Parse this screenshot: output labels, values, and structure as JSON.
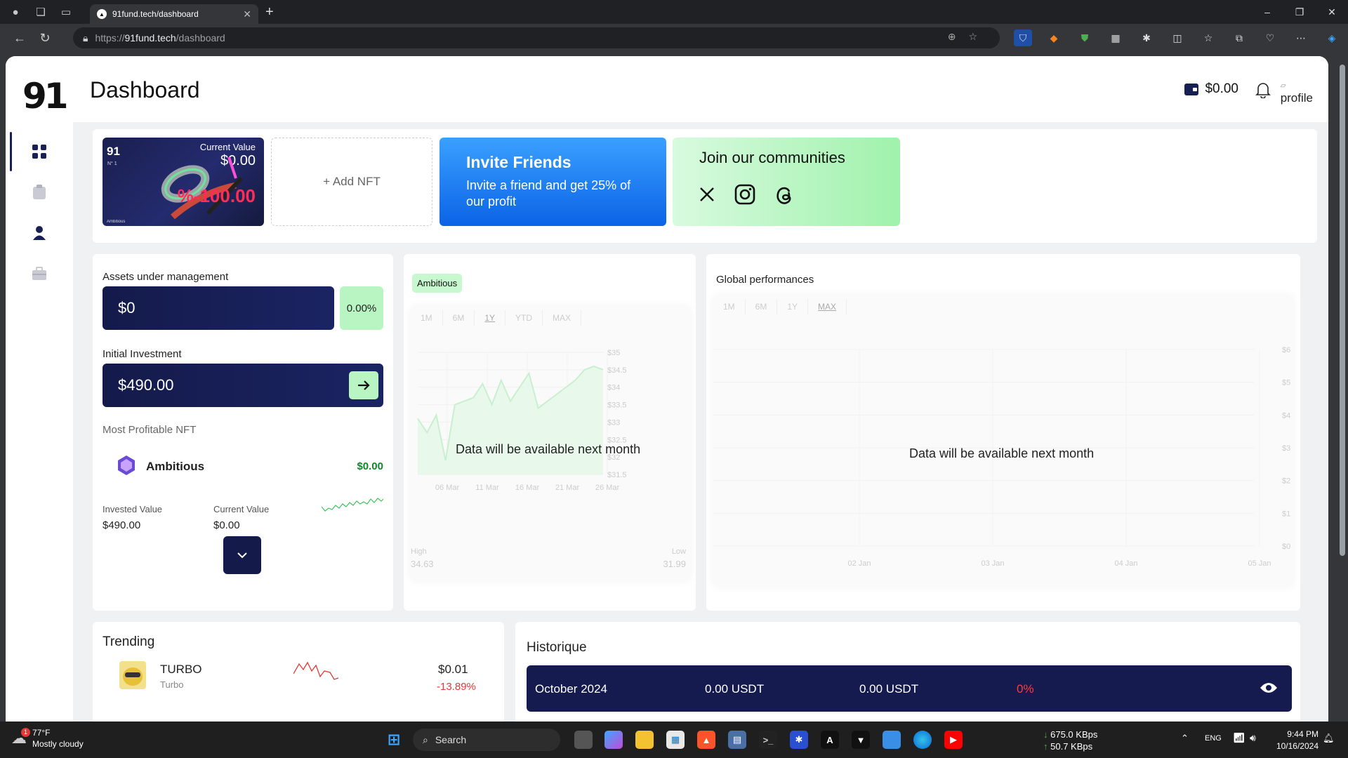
{
  "browser": {
    "tab_title": "91fund.tech/dashboard",
    "url_scheme": "https://",
    "url_host": "91fund.tech",
    "url_path": "/dashboard"
  },
  "app": {
    "logo": "91",
    "page_title": "Dashboard",
    "wallet_balance": "$0.00",
    "profile_alt": "profile"
  },
  "sidebar": {
    "items": [
      {
        "name": "dashboard",
        "icon": "grid-icon",
        "active": true
      },
      {
        "name": "portfolio",
        "icon": "clipboard-icon",
        "active": false
      },
      {
        "name": "account",
        "icon": "user-icon",
        "active": false
      },
      {
        "name": "wallet",
        "icon": "briefcase-icon",
        "active": false
      }
    ]
  },
  "nft_card": {
    "logo": "91",
    "number": "N° 1",
    "current_value_label": "Current Value",
    "current_value": "$0.00",
    "performance": "%-100.00",
    "name": "Ambitious"
  },
  "add_nft_label": "+ Add NFT",
  "invite": {
    "title": "Invite Friends",
    "description": "Invite a friend and get 25% of our profit"
  },
  "communities": {
    "title": "Join our communities",
    "links": [
      "x-icon",
      "instagram-icon",
      "threads-icon"
    ]
  },
  "assets": {
    "aum_label": "Assets under management",
    "aum_value": "$0",
    "aum_change": "0.00%",
    "initial_label": "Initial Investment",
    "initial_value": "$490.00",
    "most_profitable_label": "Most Profitable NFT",
    "nft_name": "Ambitious",
    "nft_value": "$0.00",
    "invested_label": "Invested Value",
    "invested_value": "$490.00",
    "current_label": "Current Value",
    "current_value": "$0.00"
  },
  "nft_chart": {
    "badge": "Ambitious",
    "timeframes": [
      "1M",
      "6M",
      "1Y",
      "YTD",
      "MAX"
    ],
    "selected": "1Y",
    "message": "Data will be available next month",
    "high_label": "High",
    "high_value": "34.63",
    "low_label": "Low",
    "low_value": "31.99"
  },
  "global_chart": {
    "title": "Global performances",
    "timeframes": [
      "1M",
      "6M",
      "1Y",
      "MAX"
    ],
    "selected": "MAX",
    "message": "Data will be available next month"
  },
  "chart_data": [
    {
      "type": "area",
      "title": "",
      "y_ticks": [
        "$35",
        "$34.5",
        "$34",
        "$33.5",
        "$33",
        "$32.5",
        "$32",
        "$31.5"
      ],
      "x_ticks": [
        "06 Mar",
        "11 Mar",
        "16 Mar",
        "21 Mar",
        "26 Mar"
      ],
      "ylim": [
        31.5,
        35
      ],
      "series": [
        {
          "values": [
            33.1,
            32.7,
            33.2,
            31.9,
            33.5,
            33.6,
            33.7,
            34.1,
            33.5,
            34.2,
            33.6,
            34.0,
            34.4,
            33.4,
            33.6,
            33.8,
            34.0,
            34.2,
            34.5,
            34.6,
            34.5
          ]
        }
      ]
    },
    {
      "type": "line",
      "title": "Global performances",
      "y_ticks": [
        "$6",
        "$5",
        "$4",
        "$3",
        "$2",
        "$1",
        "$0"
      ],
      "x_ticks": [
        "02 Jan",
        "03 Jan",
        "04 Jan",
        "05 Jan"
      ],
      "ylim": [
        0,
        6
      ],
      "series": []
    }
  ],
  "trending": {
    "title": "Trending",
    "items": [
      {
        "symbol": "TURBO",
        "name": "Turbo",
        "price": "$0.01",
        "change": "-13.89%"
      }
    ]
  },
  "history": {
    "title": "Historique",
    "rows": [
      {
        "period": "October 2024",
        "amount1": "0.00 USDT",
        "amount2": "0.00 USDT",
        "change": "0%"
      }
    ]
  },
  "taskbar": {
    "temperature": "77°F",
    "weather": "Mostly cloudy",
    "weather_badge": "1",
    "search_placeholder": "Search",
    "net_down": "675.0 KBps",
    "net_up": "50.7 KBps",
    "language": "ENG",
    "time": "9:44 PM",
    "date": "10/16/2024"
  }
}
